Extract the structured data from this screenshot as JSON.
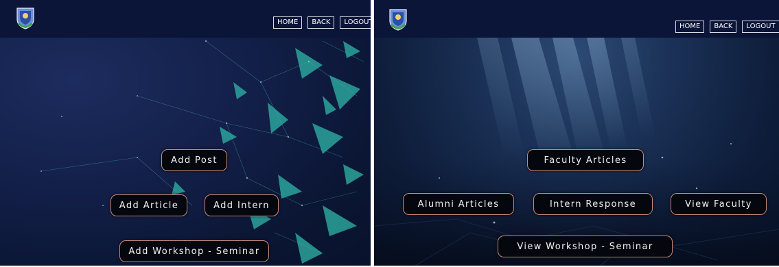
{
  "left_screen": {
    "nav": {
      "home": "HOME",
      "back": "BACK",
      "logout": "LOGOUT"
    },
    "buttons": {
      "add_post": "Add Post",
      "add_article": "Add Article",
      "add_intern": "Add Intern",
      "add_workshop": "Add Workshop - Seminar"
    }
  },
  "right_screen": {
    "nav": {
      "home": "HOME",
      "back": "BACK",
      "logout": "LOGOUT"
    },
    "buttons": {
      "faculty_articles": "Faculty Articles",
      "alumni_articles": "Alumni Articles",
      "intern_response": "Intern Response",
      "view_faculty": "View Faculty",
      "view_workshop": "View Workshop - Seminar"
    }
  },
  "colors": {
    "topbar": "#0b1538",
    "button_bg": "#05070e",
    "button_border": "#c98a7a",
    "network_accent": "#2fb5a8"
  },
  "icons": {
    "logo": "university-crest-icon"
  }
}
